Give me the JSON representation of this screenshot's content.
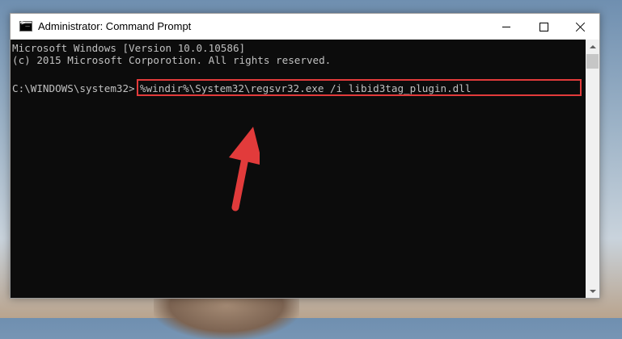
{
  "window": {
    "title": "Administrator: Command Prompt",
    "icon": "command-prompt-icon",
    "controls": [
      "minimize-icon",
      "maximize-icon",
      "close-icon"
    ]
  },
  "console": {
    "lines": [
      "Microsoft Windows [Version 10.0.10586]",
      "(c) 2015 Microsoft Corporotion. All rights reserved."
    ],
    "prompt": "C:\\WINDOWS\\system32>",
    "command": "%windir%\\System32\\regsvr32.exe /i libid3tag_plugin.dll"
  },
  "annotation": {
    "highlight_color": "#e23b3b",
    "arrow_color": "#e23b3b"
  }
}
